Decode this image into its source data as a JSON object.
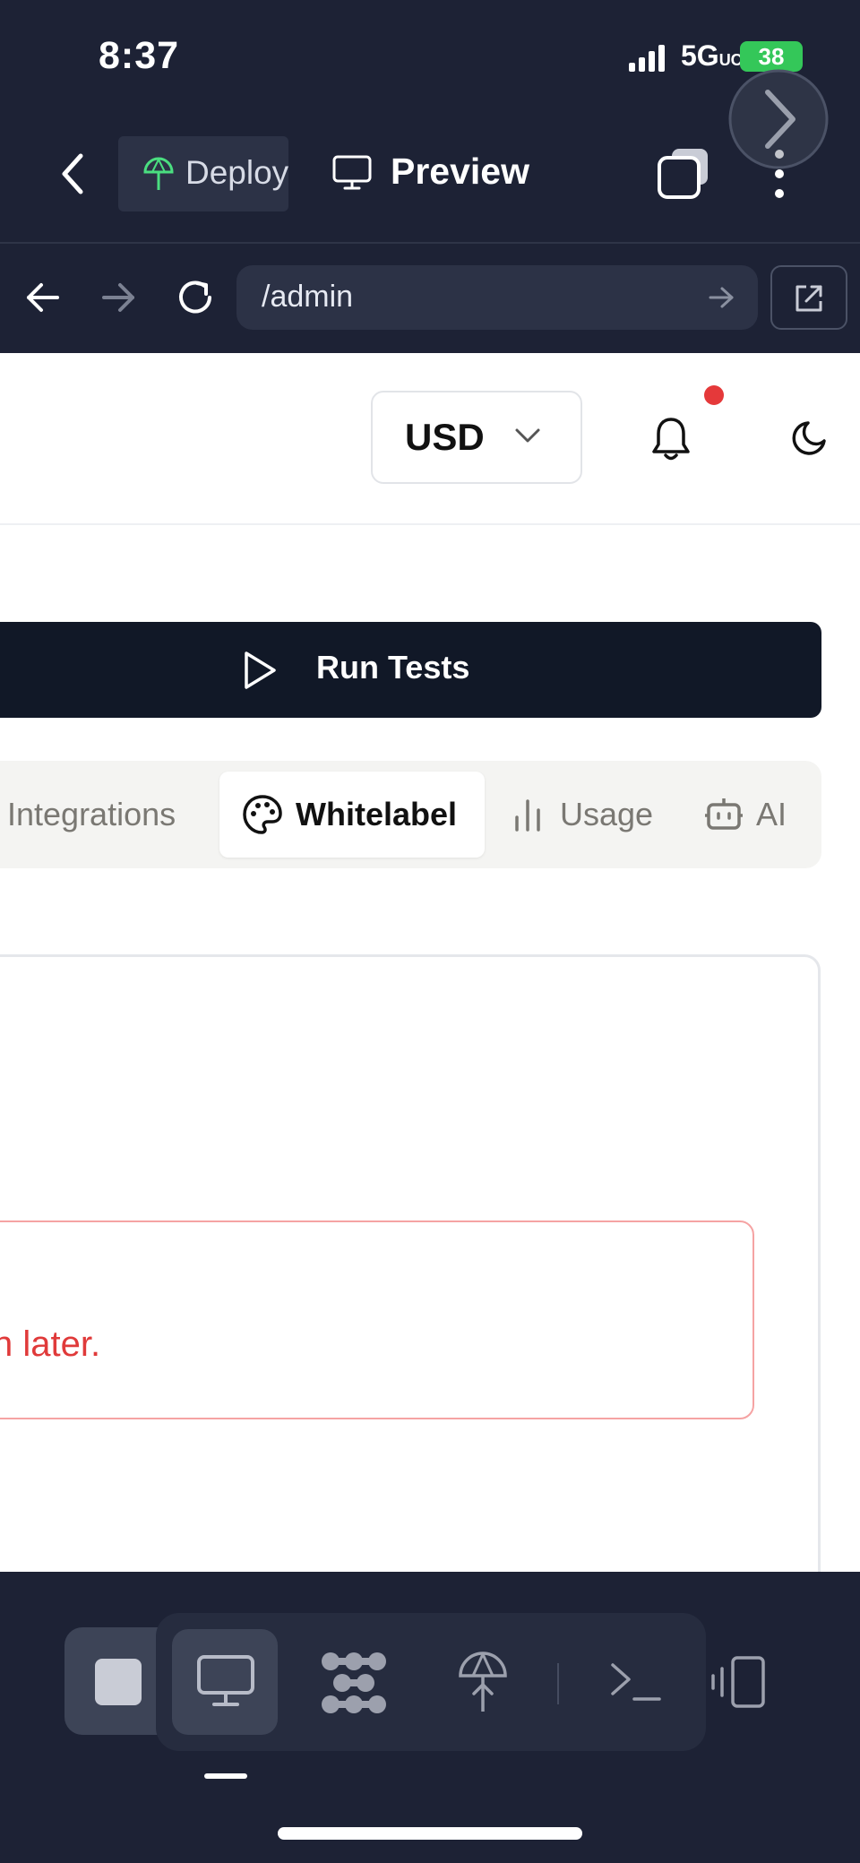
{
  "status_bar": {
    "time": "8:37",
    "network": "5G",
    "network_sub": "UC",
    "battery": "38"
  },
  "toolbar": {
    "deploy_label": "Deploy",
    "preview_label": "Preview"
  },
  "browser": {
    "url": "/admin"
  },
  "header": {
    "currency": "USD"
  },
  "actions": {
    "run_tests_label": "Run Tests"
  },
  "tabs": [
    {
      "label": "Integrations",
      "icon": "integrations",
      "active": false
    },
    {
      "label": "Whitelabel",
      "icon": "palette-icon",
      "active": true
    },
    {
      "label": "Usage",
      "icon": "bar-chart-icon",
      "active": false
    },
    {
      "label": "AI",
      "icon": "robot-icon",
      "active": false
    }
  ],
  "alert": {
    "text_visible": "n later."
  },
  "colors": {
    "chrome": "#1d2235",
    "primary_button": "#111827",
    "alert": "#e03a3a",
    "notification": "#e5393a",
    "deploy_icon": "#4ade80"
  }
}
